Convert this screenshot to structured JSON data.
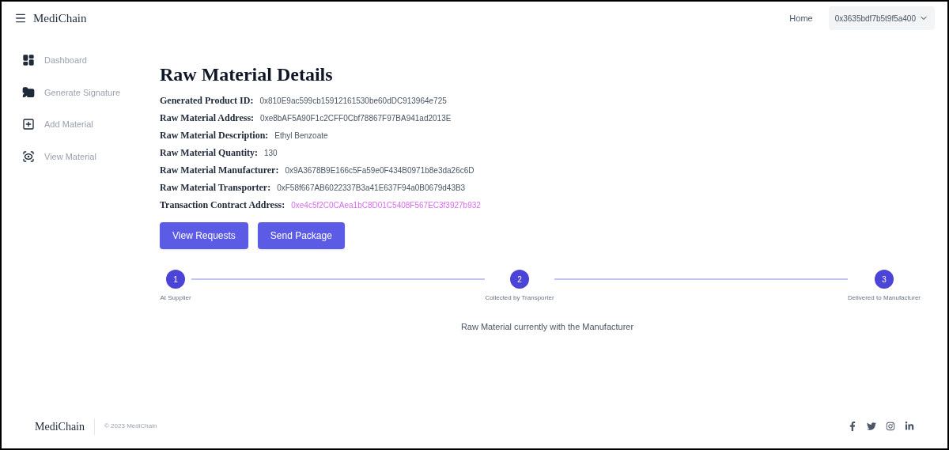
{
  "header": {
    "brand": "MediChain",
    "nav_link": "Home",
    "account": "0x3635bdf7b5t9f5a400"
  },
  "sidebar": {
    "items": [
      {
        "label": "Dashboard",
        "kind": "dashboard"
      },
      {
        "label": "Generate Signature",
        "kind": "signature"
      },
      {
        "label": "Add Material",
        "kind": "add"
      },
      {
        "label": "View Material",
        "kind": "view"
      }
    ]
  },
  "main": {
    "title": "Raw Material Details",
    "fields": [
      {
        "label": "Generated Product ID:",
        "value": "0x810E9ac599cb15912161530be60dDC913964e725",
        "kind": "text"
      },
      {
        "label": "Raw Material Address:",
        "value": "0xe8bAF5A90F1c2CFF0Cbf78867F97BA941ad2013E",
        "kind": "text"
      },
      {
        "label": "Raw Material Description:",
        "value": "Ethyl Benzoate",
        "kind": "text"
      },
      {
        "label": "Raw Material Quantity:",
        "value": "130",
        "kind": "text"
      },
      {
        "label": "Raw Material Manufacturer:",
        "value": "0x9A3678B9E166c5Fa59e0F434B0971b8e3da26c6D",
        "kind": "text"
      },
      {
        "label": "Raw Material Transporter:",
        "value": "0xF58f667AB6022337B3a41E637F94a0B0679d43B3",
        "kind": "text"
      },
      {
        "label": "Transaction Contract Address:",
        "value": "0xe4c5f2C0CAea1bC8D01C5408F567EC3f3927b932",
        "kind": "link"
      }
    ],
    "buttons": [
      "View Requests",
      "Send Package"
    ],
    "steps": [
      {
        "number": "1",
        "label": "At Supplier",
        "completed": true
      },
      {
        "number": "2",
        "label": "Collected by Transporter",
        "completed": true
      },
      {
        "number": "3",
        "label": "Delivered to Manufacturer",
        "completed": true
      }
    ],
    "status": "Raw Material currently with the Manufacturer"
  },
  "footer": {
    "brand": "MediChain",
    "copyright": "© 2023 MediChain"
  }
}
